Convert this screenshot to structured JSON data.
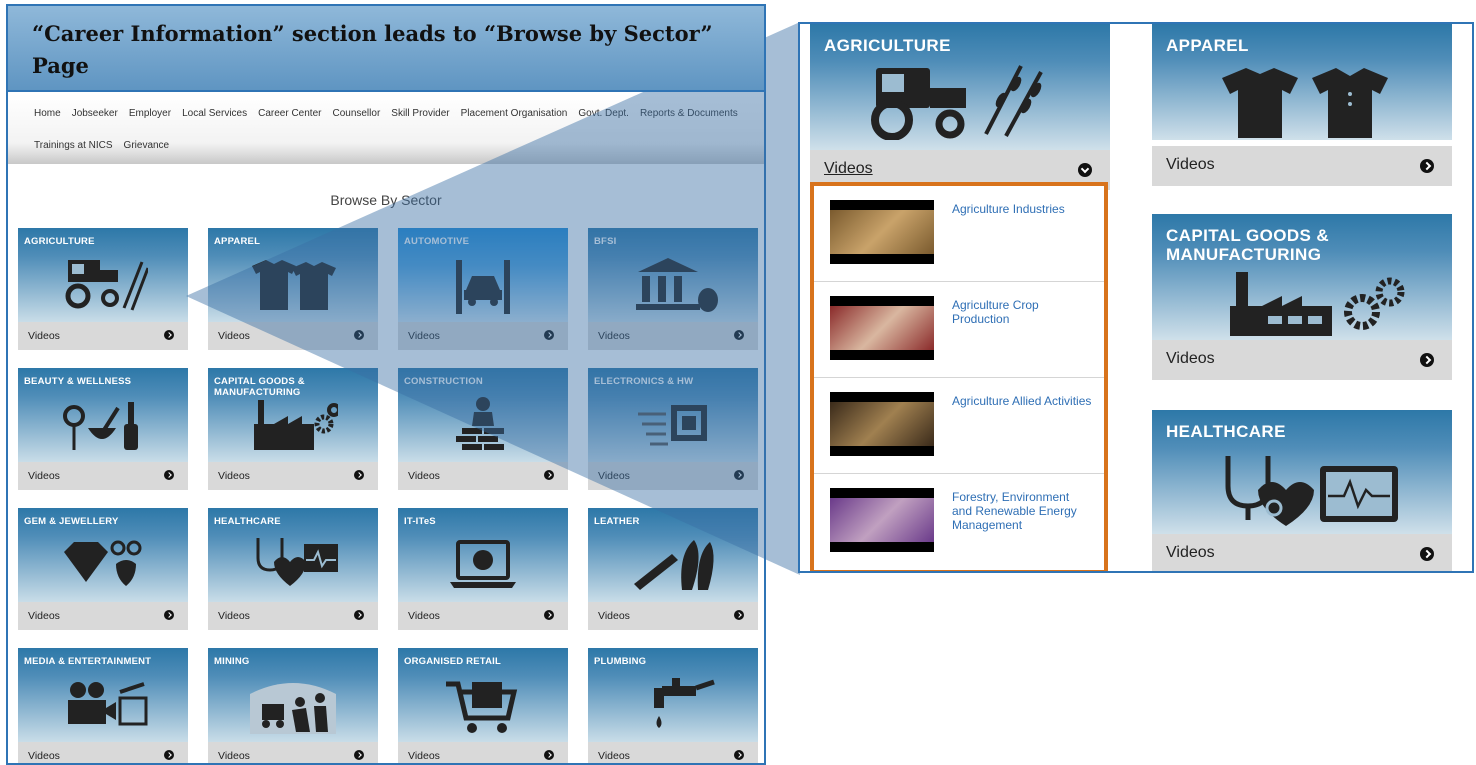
{
  "caption": "“Career Information” section leads to “Browse by Sector” Page",
  "nav": {
    "row1": [
      "Home",
      "Jobseeker",
      "Employer",
      "Local Services",
      "Career Center",
      "Counsellor",
      "Skill Provider",
      "Placement Organisation",
      "Govt. Dept.",
      "Reports & Documents"
    ],
    "row2": [
      "Trainings at NICS",
      "Grievance"
    ]
  },
  "browse_title": "Browse By Sector",
  "videos_label": "Videos",
  "sectors": [
    {
      "name": "AGRICULTURE",
      "icon": "tractor-icon"
    },
    {
      "name": "APPAREL",
      "icon": "shirts-icon"
    },
    {
      "name": "AUTOMOTIVE",
      "icon": "car-lift-icon"
    },
    {
      "name": "BFSI",
      "icon": "bank-icon"
    },
    {
      "name": "BEAUTY & WELLNESS",
      "icon": "beauty-icon"
    },
    {
      "name": "CAPITAL GOODS & MANUFACTURING",
      "icon": "factory-icon"
    },
    {
      "name": "CONSTRUCTION",
      "icon": "bricklayer-icon"
    },
    {
      "name": "ELECTRONICS & HW",
      "icon": "chip-icon"
    },
    {
      "name": "GEM & JEWELLERY",
      "icon": "diamond-icon"
    },
    {
      "name": "HEALTHCARE",
      "icon": "stethoscope-icon"
    },
    {
      "name": "IT-ITeS",
      "icon": "laptop-icon"
    },
    {
      "name": "LEATHER",
      "icon": "shoes-belt-icon"
    },
    {
      "name": "MEDIA & ENTERTAINMENT",
      "icon": "camera-icon"
    },
    {
      "name": "MINING",
      "icon": "miner-icon"
    },
    {
      "name": "ORGANISED RETAIL",
      "icon": "cart-icon"
    },
    {
      "name": "PLUMBING",
      "icon": "tap-icon"
    }
  ],
  "zoom": {
    "agriculture": "AGRICULTURE",
    "apparel": "APPAREL",
    "capital": "CAPITAL GOODS & MANUFACTURING",
    "healthcare": "HEALTHCARE",
    "videos": [
      {
        "title": "Agriculture Industries"
      },
      {
        "title": "Agriculture Crop Production"
      },
      {
        "title": "Agriculture Allied Activities"
      },
      {
        "title": "Forestry, Environment and Renewable Energy Management"
      }
    ]
  },
  "colors": {
    "accent_border": "#2f74b5",
    "highlight": "#d8731c",
    "tile_band": "#4f8db8",
    "link": "#2f6fb5"
  }
}
